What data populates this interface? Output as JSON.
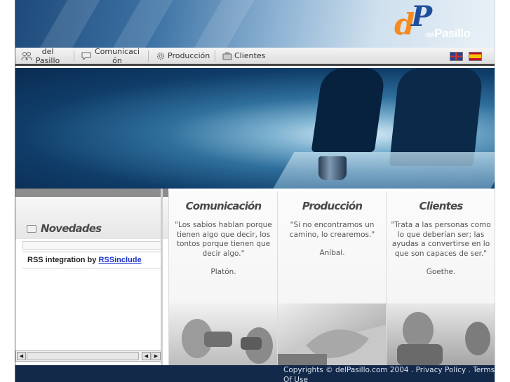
{
  "header": {
    "logo_mark_left": "d",
    "logo_mark_right": "P",
    "logo_del": "del",
    "logo_name": "Pasillo"
  },
  "nav": {
    "items": [
      {
        "label": "del Pasillo",
        "icon": "people-icon"
      },
      {
        "label": "Comunicación",
        "icon": "speech-bubble-icon"
      },
      {
        "label": "Producción",
        "icon": "gear-icon"
      },
      {
        "label": "Clientes",
        "icon": "briefcase-icon"
      }
    ],
    "languages": [
      "english-flag-icon",
      "spanish-flag-icon"
    ]
  },
  "sidebar": {
    "title": "Novedades",
    "rss_prefix": "RSS integration by ",
    "rss_link": "RSSinclude"
  },
  "columns": [
    {
      "title": "Comunicación",
      "quote": "\"Los sabios hablan porque tienen algo que decir, los tontos porque tienen que decir algo.\"",
      "author": "Platón."
    },
    {
      "title": "Producción",
      "quote": "\"Si no encontramos un camino, lo crearemos.\"",
      "author": "Aníbal."
    },
    {
      "title": "Clientes",
      "quote": "\"Trata a las personas como lo que deberían ser; las ayudas a convertirse en lo que son capaces de ser.\"",
      "author": "Goethe."
    }
  ],
  "footer": {
    "text": "Copyrights © delPasillo.com 2004 . Privacy Policy . Terms Of Use"
  }
}
